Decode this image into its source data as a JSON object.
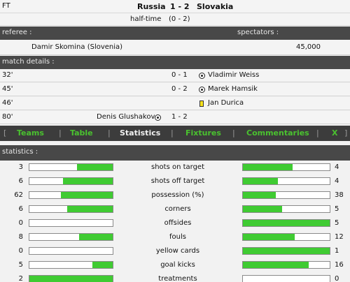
{
  "match": {
    "status": "FT",
    "home_team": "Russia",
    "score": "1 - 2",
    "away_team": "Slovakia",
    "halftime_label": "half-time",
    "halftime_score": "(0 - 2)"
  },
  "referee_section": {
    "referee_label": "referee :",
    "spectators_label": "spectators :",
    "referee_name": "Damir Skomina (Slovenia)",
    "spectators_value": "45,000"
  },
  "match_details": {
    "title": "match details :",
    "events": [
      {
        "minute": "32'",
        "score": "0 - 1",
        "player": "Vladimir Weiss",
        "side": "away",
        "type": "goal"
      },
      {
        "minute": "45'",
        "score": "0 - 2",
        "player": "Marek Hamsik",
        "side": "away",
        "type": "goal"
      },
      {
        "minute": "46'",
        "score": "",
        "player": "Jan Durica",
        "side": "away",
        "type": "yellow-card"
      },
      {
        "minute": "80'",
        "score": "1 - 2",
        "player": "Denis Glushakov",
        "side": "home",
        "type": "goal"
      }
    ]
  },
  "nav": {
    "open_bracket": "[",
    "close_bracket": "]",
    "separator": "|",
    "items": [
      "Teams",
      "Table",
      "Statistics",
      "Fixtures",
      "Commentaries",
      "X"
    ],
    "active": "Statistics"
  },
  "statistics": {
    "title": "statistics :",
    "rows": [
      {
        "label": "shots on target",
        "home": "3",
        "away": "4",
        "home_fraction": 0.43,
        "away_fraction": 0.57
      },
      {
        "label": "shots off target",
        "home": "6",
        "away": "4",
        "home_fraction": 0.6,
        "away_fraction": 0.4
      },
      {
        "label": "possession (%)",
        "home": "62",
        "away": "38",
        "home_fraction": 0.62,
        "away_fraction": 0.38
      },
      {
        "label": "corners",
        "home": "6",
        "away": "5",
        "home_fraction": 0.55,
        "away_fraction": 0.45
      },
      {
        "label": "offsides",
        "home": "0",
        "away": "5",
        "home_fraction": 0.0,
        "away_fraction": 1.0
      },
      {
        "label": "fouls",
        "home": "8",
        "away": "12",
        "home_fraction": 0.4,
        "away_fraction": 0.6
      },
      {
        "label": "yellow cards",
        "home": "0",
        "away": "1",
        "home_fraction": 0.0,
        "away_fraction": 1.0
      },
      {
        "label": "goal kicks",
        "home": "5",
        "away": "16",
        "home_fraction": 0.24,
        "away_fraction": 0.76
      },
      {
        "label": "treatments",
        "home": "2",
        "away": "0",
        "home_fraction": 1.0,
        "away_fraction": 0.0
      }
    ]
  },
  "colors": {
    "bar_fill": "#3fcb32",
    "nav_link": "#4ac22f",
    "header_bg": "#484848",
    "yellow_card": "#f7e21c"
  }
}
